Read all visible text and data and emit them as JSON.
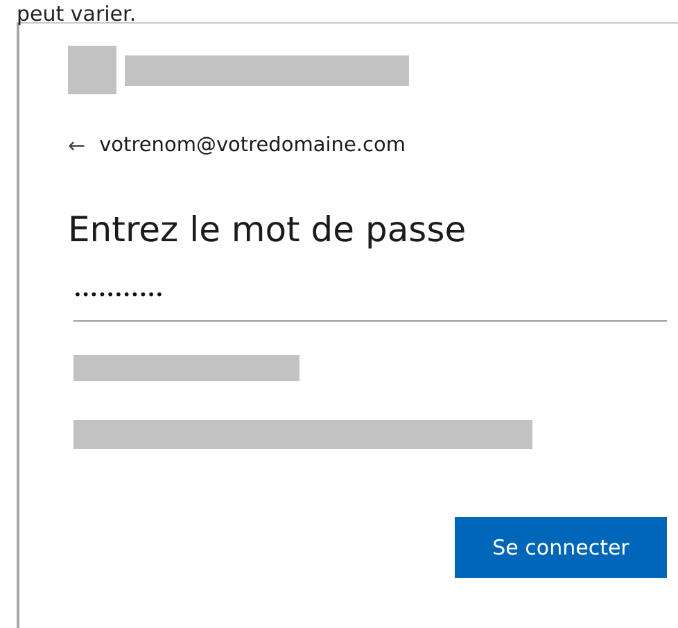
{
  "caption": "peut varier.",
  "back_link": {
    "icon": "←",
    "text": "votrenom@votredomaine.com"
  },
  "heading": "Entrez le mot de passe",
  "password_field": {
    "value": "•••••••••••"
  },
  "buttons": [
    {
      "label": "Se connecter",
      "kind": "primary"
    }
  ]
}
